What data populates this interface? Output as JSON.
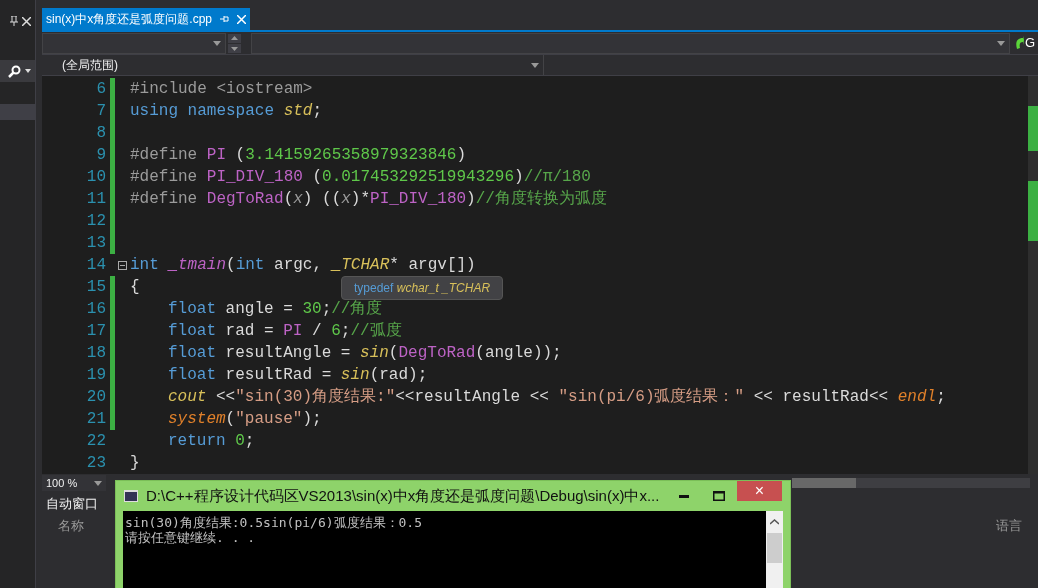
{
  "document_tab": {
    "title": "sin(x)中x角度还是弧度问题.cpp",
    "selected": true
  },
  "navigation": {
    "scope": "(全局范围)",
    "go_button": "G"
  },
  "code_lines": [
    {
      "number": "6",
      "changed": true,
      "tokens": [
        {
          "kind": "preprocessor",
          "text": "#include <iostream>"
        }
      ]
    },
    {
      "number": "7",
      "changed": true,
      "tokens": [
        {
          "kind": "keyword",
          "text": "using namespace "
        },
        {
          "kind": "type",
          "text": "std"
        },
        {
          "kind": "plain",
          "text": ";"
        }
      ]
    },
    {
      "number": "8",
      "changed": true
    },
    {
      "number": "9",
      "changed": true,
      "tokens": [
        {
          "kind": "preprocessor",
          "text": "#define "
        },
        {
          "kind": "macro",
          "text": "PI"
        },
        {
          "kind": "plain",
          "text": " ("
        },
        {
          "kind": "number",
          "text": "3.14159265358979323846"
        },
        {
          "kind": "plain",
          "text": ")"
        }
      ]
    },
    {
      "number": "10",
      "changed": true,
      "tokens": [
        {
          "kind": "preprocessor",
          "text": "#define "
        },
        {
          "kind": "macro",
          "text": "PI_DIV_180"
        },
        {
          "kind": "plain",
          "text": " ("
        },
        {
          "kind": "number",
          "text": "0.017453292519943296"
        },
        {
          "kind": "plain",
          "text": ")"
        },
        {
          "kind": "comment",
          "text": "//π/180"
        }
      ]
    },
    {
      "number": "11",
      "changed": true,
      "tokens": [
        {
          "kind": "preprocessor",
          "text": "#define "
        },
        {
          "kind": "macro",
          "text": "DegToRad"
        },
        {
          "kind": "plain",
          "text": "("
        },
        {
          "kind": "param",
          "text": "x"
        },
        {
          "kind": "plain",
          "text": ") (("
        },
        {
          "kind": "param",
          "text": "x"
        },
        {
          "kind": "plain",
          "text": ")*"
        },
        {
          "kind": "macro",
          "text": "PI_DIV_180"
        },
        {
          "kind": "plain",
          "text": ")"
        },
        {
          "kind": "comment",
          "text": "//角度转换为弧度"
        }
      ]
    },
    {
      "number": "12",
      "changed": true
    },
    {
      "number": "13",
      "changed": true
    },
    {
      "number": "14",
      "changed": false,
      "fold": true,
      "tokens": [
        {
          "kind": "keyword",
          "text": "int "
        },
        {
          "kind": "function",
          "text": "_tmain"
        },
        {
          "kind": "plain",
          "text": "("
        },
        {
          "kind": "keyword",
          "text": "int"
        },
        {
          "kind": "plain",
          "text": " argc, "
        },
        {
          "kind": "type",
          "text": "_TCHAR"
        },
        {
          "kind": "plain",
          "text": "* argv[])"
        }
      ]
    },
    {
      "number": "15",
      "changed": true,
      "tokens": [
        {
          "kind": "plain",
          "text": "{"
        }
      ]
    },
    {
      "number": "16",
      "changed": true,
      "indented": true,
      "tokens": [
        {
          "kind": "keyword",
          "text": "float"
        },
        {
          "kind": "plain",
          "text": " angle = "
        },
        {
          "kind": "number",
          "text": "30"
        },
        {
          "kind": "plain",
          "text": ";"
        },
        {
          "kind": "comment",
          "text": "//角度"
        }
      ]
    },
    {
      "number": "17",
      "changed": true,
      "indented": true,
      "tokens": [
        {
          "kind": "keyword",
          "text": "float"
        },
        {
          "kind": "plain",
          "text": " rad = "
        },
        {
          "kind": "macro",
          "text": "PI"
        },
        {
          "kind": "plain",
          "text": " / "
        },
        {
          "kind": "number",
          "text": "6"
        },
        {
          "kind": "plain",
          "text": ";"
        },
        {
          "kind": "comment",
          "text": "//弧度"
        }
      ]
    },
    {
      "number": "18",
      "changed": true,
      "indented": true,
      "tokens": [
        {
          "kind": "keyword",
          "text": "float"
        },
        {
          "kind": "plain",
          "text": " resultAngle = "
        },
        {
          "kind": "type",
          "text": "sin"
        },
        {
          "kind": "plain",
          "text": "("
        },
        {
          "kind": "macro",
          "text": "DegToRad"
        },
        {
          "kind": "plain",
          "text": "(angle));"
        }
      ]
    },
    {
      "number": "19",
      "changed": true,
      "indented": true,
      "tokens": [
        {
          "kind": "keyword",
          "text": "float"
        },
        {
          "kind": "plain",
          "text": " resultRad = "
        },
        {
          "kind": "type",
          "text": "sin"
        },
        {
          "kind": "plain",
          "text": "(rad);"
        }
      ]
    },
    {
      "number": "20",
      "changed": true,
      "indented": true,
      "tokens": [
        {
          "kind": "type",
          "text": "cout"
        },
        {
          "kind": "plain",
          "text": " <<"
        },
        {
          "kind": "string",
          "text": "\"sin(30)角度结果:\""
        },
        {
          "kind": "plain",
          "text": "<<resultAngle << "
        },
        {
          "kind": "string",
          "text": "\"sin(pi/6)弧度结果：\""
        },
        {
          "kind": "plain",
          "text": " << resultRad<< "
        },
        {
          "kind": "special",
          "text": "endl"
        },
        {
          "kind": "plain",
          "text": ";"
        }
      ]
    },
    {
      "number": "21",
      "changed": true,
      "indented": true,
      "tokens": [
        {
          "kind": "special",
          "text": "system"
        },
        {
          "kind": "plain",
          "text": "("
        },
        {
          "kind": "string",
          "text": "\"pause\""
        },
        {
          "kind": "plain",
          "text": ");"
        }
      ]
    },
    {
      "number": "22",
      "changed": false,
      "indented": true,
      "tokens": [
        {
          "kind": "keyword",
          "text": "return "
        },
        {
          "kind": "number",
          "text": "0"
        },
        {
          "kind": "plain",
          "text": ";"
        }
      ]
    },
    {
      "number": "23",
      "changed": false,
      "tokens": [
        {
          "kind": "plain",
          "text": "}"
        }
      ]
    }
  ],
  "tooltip": {
    "keyword": "typedef",
    "type": "wchar_t _TCHAR"
  },
  "zoom": "100 %",
  "autos_panel": {
    "title": "自动窗口",
    "columns": [
      "名称",
      "语言"
    ]
  },
  "console": {
    "title": "D:\\C++程序设计代码区VS2013\\sin(x)中x角度还是弧度问题\\Debug\\sin(x)中x...",
    "close": "×",
    "output": [
      "sin(30)角度结果:0.5sin(pi/6)弧度结果：0.5",
      "请按任意键继续. . ."
    ]
  }
}
